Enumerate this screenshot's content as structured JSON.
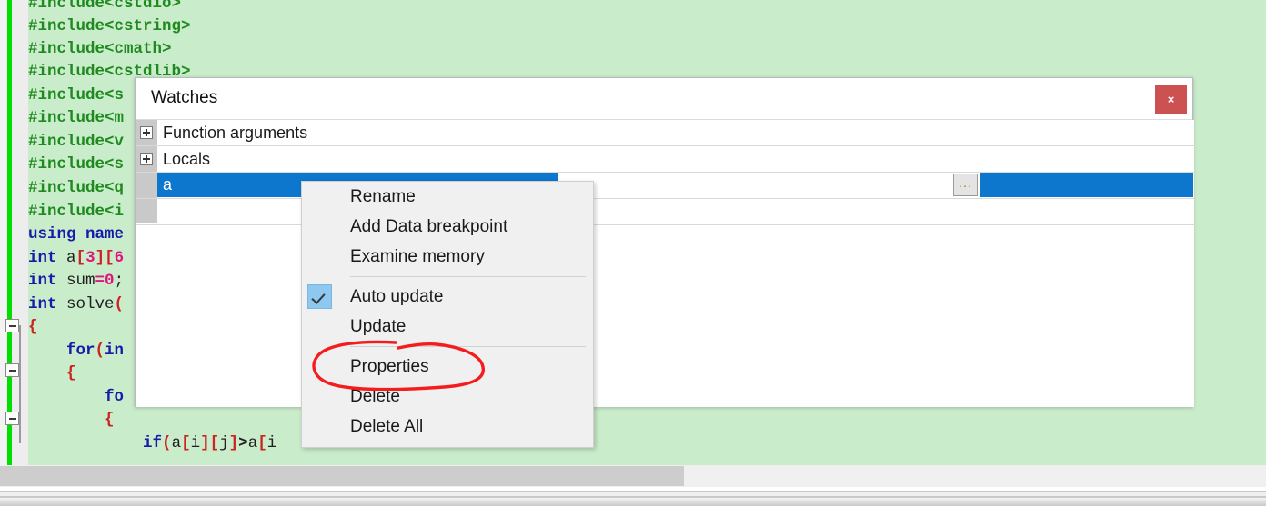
{
  "editor": {
    "language": "C++",
    "background_color": "#c9ecca",
    "lines": [
      "#include<cstdio>",
      "#include<cstring>",
      "#include<cmath>",
      "#include<cstdlib>",
      "#include<s",
      "#include<m",
      "#include<v",
      "#include<s",
      "#include<q",
      "#include<i",
      "using name",
      "int a[3][6",
      "int sum=0;",
      "int solve(",
      "{",
      "    for(in",
      "    {",
      "        fo",
      "        {",
      "            if(a[i][j]>a[i"
    ]
  },
  "dialog": {
    "title": "Watches",
    "close_label": "×",
    "close_icon": "close-icon",
    "close_color": "#cc5252"
  },
  "watch_table": {
    "rows": [
      {
        "label": "Function arguments",
        "expandable": true,
        "selected": false
      },
      {
        "label": "Locals",
        "expandable": true,
        "selected": false
      },
      {
        "label": "a",
        "expandable": false,
        "selected": true,
        "ellipsis_label": "..."
      },
      {
        "label": "",
        "expandable": false,
        "selected": false
      }
    ],
    "selection_color": "#0d77cd"
  },
  "context_menu": {
    "items": [
      {
        "label": "Rename",
        "checked": false,
        "separator_after": false
      },
      {
        "label": "Add Data breakpoint",
        "checked": false,
        "separator_after": false
      },
      {
        "label": "Examine memory",
        "checked": false,
        "separator_after": true
      },
      {
        "label": "Auto update",
        "checked": true,
        "separator_after": false
      },
      {
        "label": "Update",
        "checked": false,
        "separator_after": true
      },
      {
        "label": "Properties",
        "checked": false,
        "separator_after": false
      },
      {
        "label": "Delete",
        "checked": false,
        "separator_after": false
      },
      {
        "label": "Delete All",
        "checked": false,
        "separator_after": false
      }
    ]
  },
  "annotation": {
    "target": "Properties",
    "shape": "ellipse",
    "color": "#f41c1c"
  }
}
